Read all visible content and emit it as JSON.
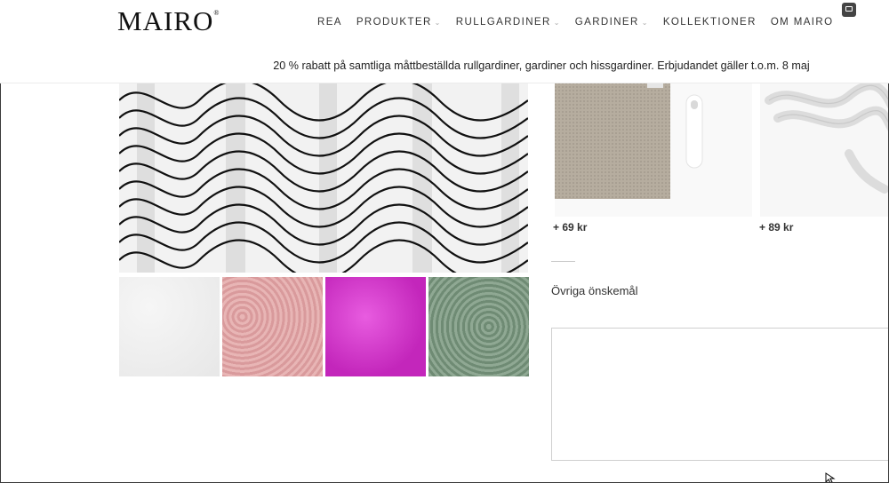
{
  "brand": {
    "logo": "MAIRO",
    "mark": "®"
  },
  "nav": [
    {
      "label": "REA",
      "dropdown": false
    },
    {
      "label": "PRODUKTER",
      "dropdown": true
    },
    {
      "label": "RULLGARDINER",
      "dropdown": true
    },
    {
      "label": "GARDINER",
      "dropdown": true
    },
    {
      "label": "KOLLEKTIONER",
      "dropdown": false
    },
    {
      "label": "OM MAIRO",
      "dropdown": false
    }
  ],
  "promo": "20 % rabatt på samtliga måttbeställda rullgardiner, gardiner och hissgardiner. Erbjudandet gäller t.o.m. 8 maj",
  "options": [
    {
      "price": "+ 69 kr"
    },
    {
      "price": "+ 89 kr"
    }
  ],
  "wish": {
    "label": "Övriga önskemål",
    "value": ""
  },
  "colors": {
    "thumb_white": "#e9e9e9",
    "thumb_pink": "#dba3a5",
    "thumb_magenta": "#d43dcc",
    "thumb_green": "#7c9780"
  }
}
